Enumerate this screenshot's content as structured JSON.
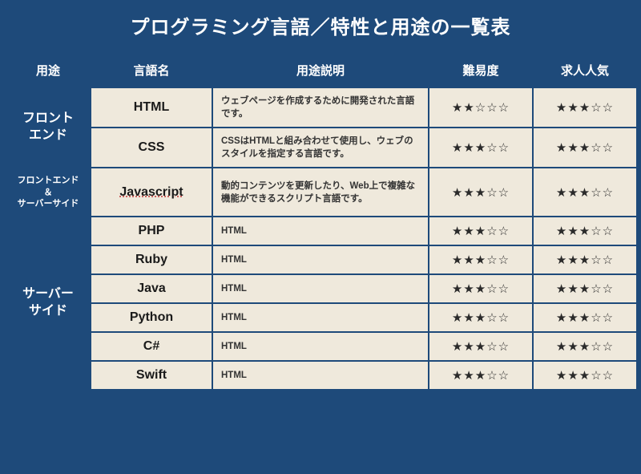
{
  "title": "プログラミング言語／特性と用途の一覧表",
  "headers": {
    "category": "用途",
    "language": "言語名",
    "description": "用途説明",
    "difficulty": "難易度",
    "popularity": "求人人気"
  },
  "categories": {
    "frontend": "フロント\nエンド",
    "both": "フロントエンド＆\nサーバーサイド",
    "server": "サーバー\nサイド"
  },
  "rows": [
    {
      "cat": "frontend",
      "catSpan": 2,
      "lang": "HTML",
      "desc": "ウェブページを作成するために開発された言語です。",
      "difficulty": "★★☆☆☆",
      "popularity": "★★★☆☆"
    },
    {
      "cat": "",
      "lang": "CSS",
      "desc": "CSSはHTMLと組み合わせて使用し、ウェブのスタイルを指定する言語です。",
      "difficulty": "★★★☆☆",
      "popularity": "★★★☆☆"
    },
    {
      "cat": "both",
      "catSpan": 1,
      "catSmall": true,
      "lang": "Javascript",
      "underline": true,
      "desc": "動的コンテンツを更新したり、Web上で複雑な機能ができるスクリプト言語です。",
      "difficulty": "★★★☆☆",
      "popularity": "★★★☆☆"
    },
    {
      "cat": "server",
      "catSpan": 6,
      "lang": "PHP",
      "desc": "HTML",
      "difficulty": "★★★☆☆",
      "popularity": "★★★☆☆"
    },
    {
      "cat": "",
      "lang": "Ruby",
      "desc": "HTML",
      "difficulty": "★★★☆☆",
      "popularity": "★★★☆☆"
    },
    {
      "cat": "",
      "lang": "Java",
      "desc": "HTML",
      "difficulty": "★★★☆☆",
      "popularity": "★★★☆☆"
    },
    {
      "cat": "",
      "lang": "Python",
      "desc": "HTML",
      "difficulty": "★★★☆☆",
      "popularity": "★★★☆☆"
    },
    {
      "cat": "",
      "lang": "C#",
      "desc": "HTML",
      "difficulty": "★★★☆☆",
      "popularity": "★★★☆☆"
    },
    {
      "cat": "",
      "lang": "Swift",
      "desc": "HTML",
      "difficulty": "★★★☆☆",
      "popularity": "★★★☆☆"
    }
  ]
}
